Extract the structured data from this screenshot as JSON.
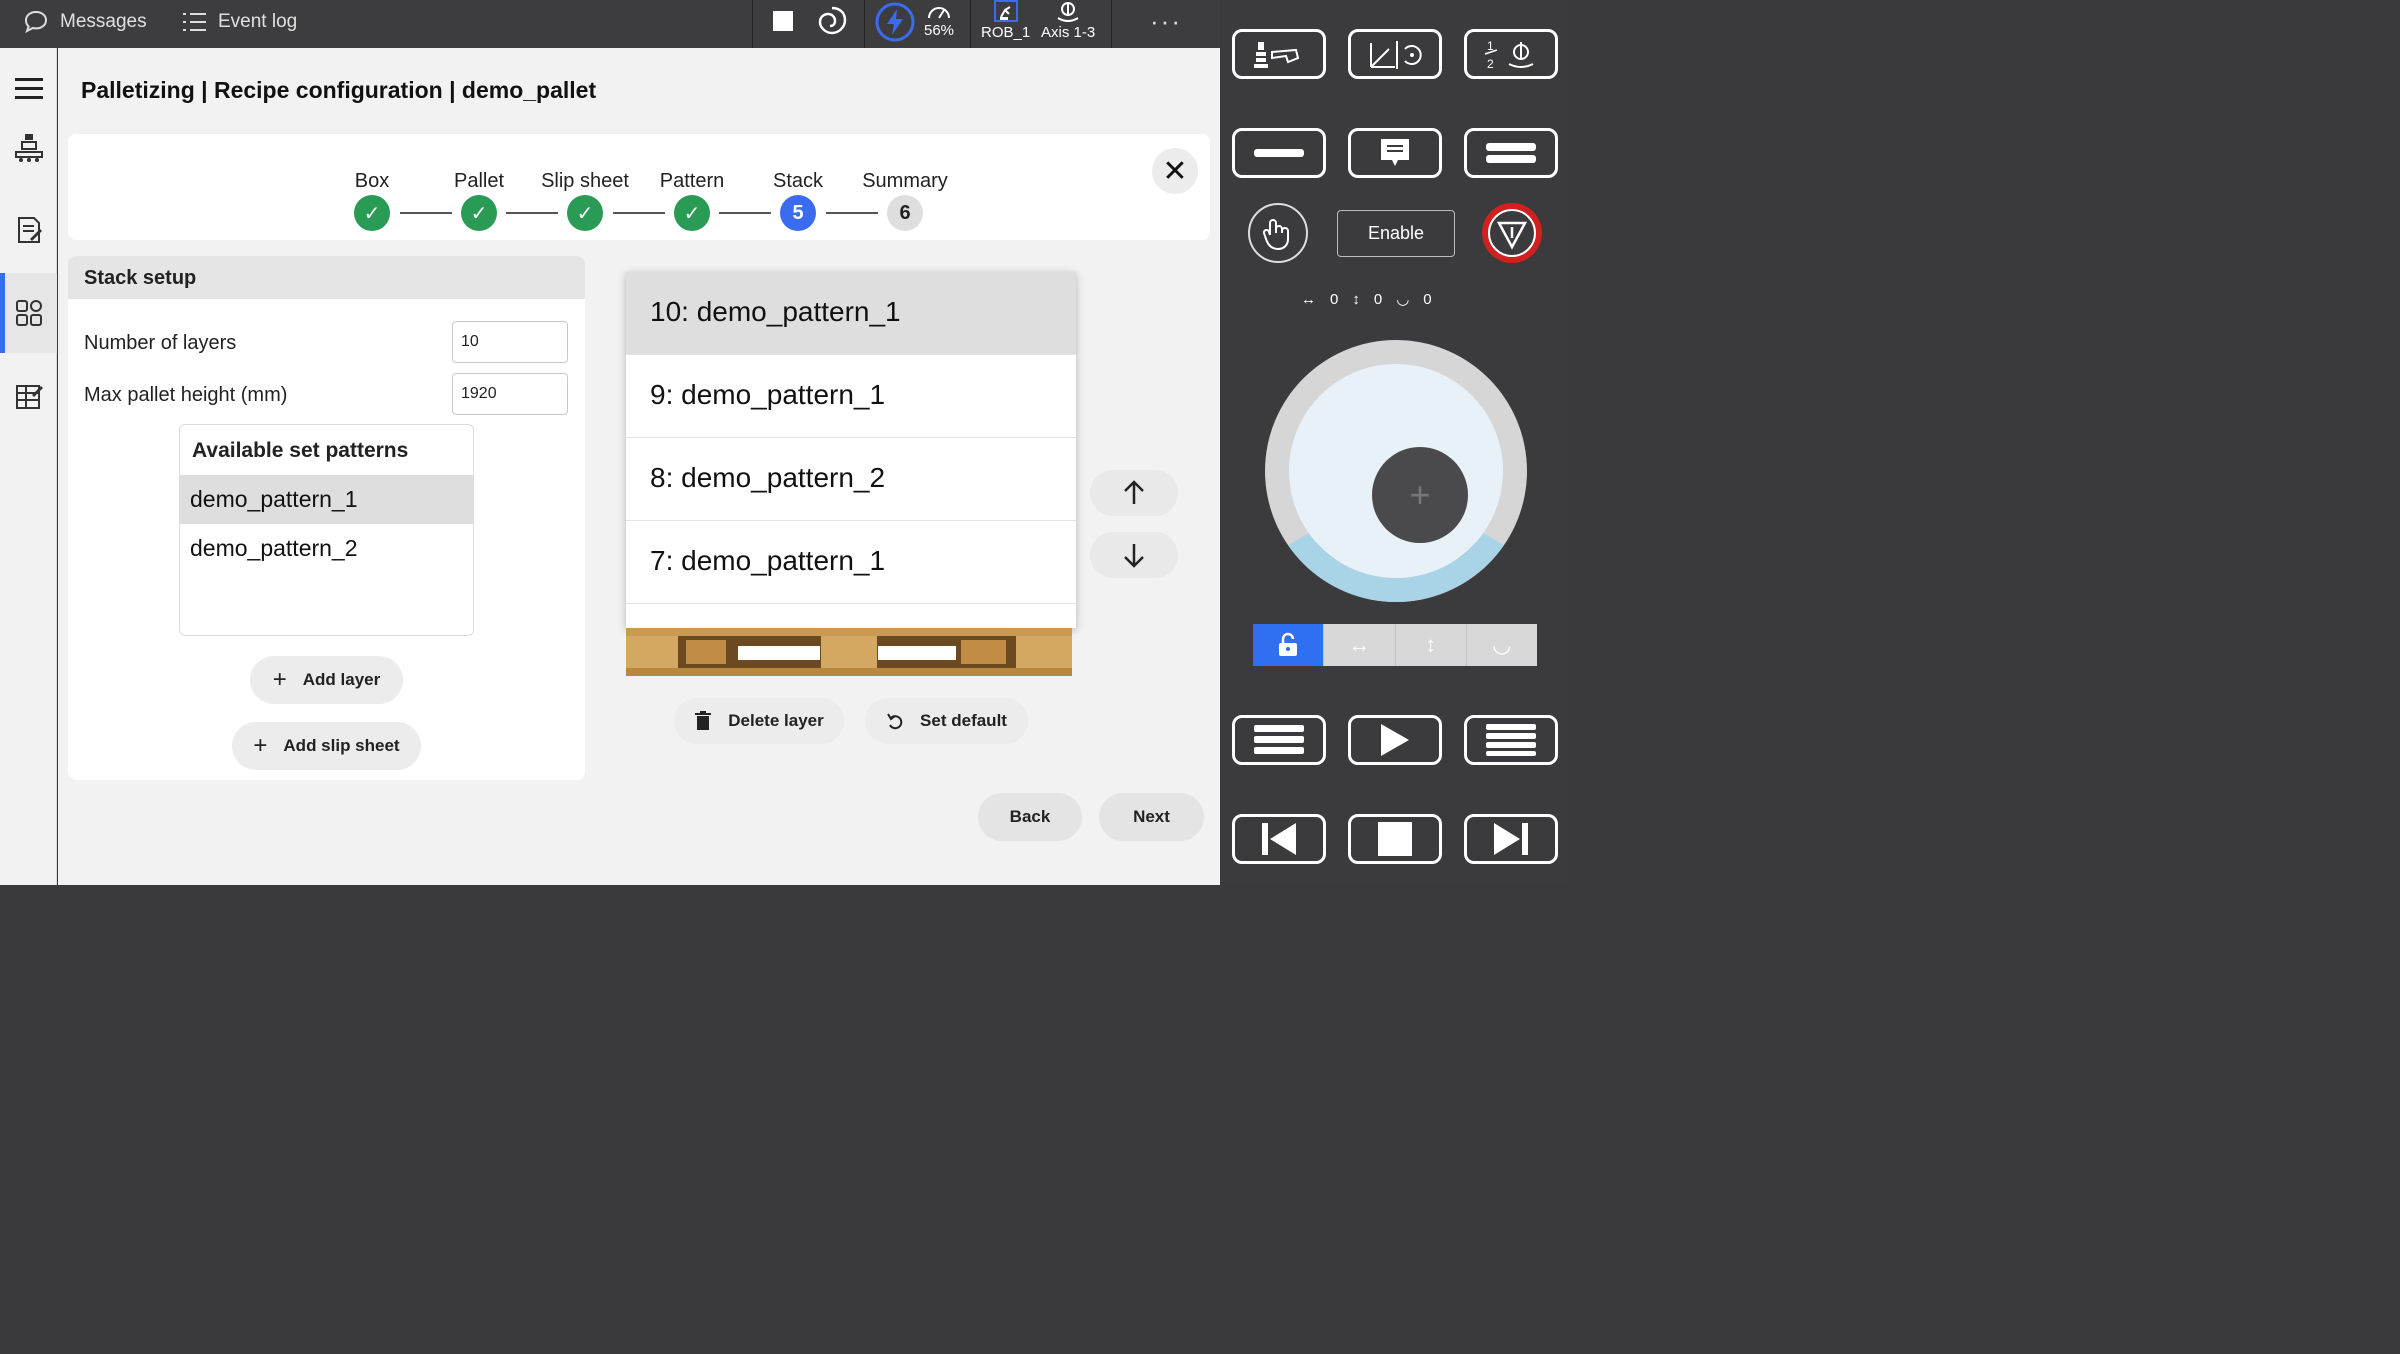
{
  "topbar": {
    "messages_label": "Messages",
    "eventlog_label": "Event log",
    "speed_label": "56%",
    "rob_label": "ROB_1",
    "axis_label": "Axis 1-3",
    "more_label": "···"
  },
  "page": {
    "title": "Palletizing | Recipe configuration | demo_pallet"
  },
  "stepper": {
    "steps": [
      {
        "label": "Box",
        "status": "done",
        "mark": "✓"
      },
      {
        "label": "Pallet",
        "status": "done",
        "mark": "✓"
      },
      {
        "label": "Slip sheet",
        "status": "done",
        "mark": "✓"
      },
      {
        "label": "Pattern",
        "status": "done",
        "mark": "✓"
      },
      {
        "label": "Stack",
        "status": "active",
        "mark": "5"
      },
      {
        "label": "Summary",
        "status": "todo",
        "mark": "6"
      }
    ],
    "close_glyph": "✕"
  },
  "setup": {
    "header": "Stack setup",
    "layers_label": "Number of layers",
    "layers_value": "10",
    "height_label": "Max pallet height (mm)",
    "height_value": "1920",
    "available_title": "Available set patterns",
    "available": [
      "demo_pattern_1",
      "demo_pattern_2"
    ],
    "add_layer": "Add layer",
    "add_slip_sheet": "Add slip sheet"
  },
  "stack": {
    "layers": [
      "10: demo_pattern_1",
      "9: demo_pattern_1",
      "8: demo_pattern_2",
      "7: demo_pattern_1"
    ],
    "delete_layer": "Delete layer",
    "set_default": "Set default"
  },
  "nav": {
    "back": "Back",
    "next": "Next"
  },
  "panel": {
    "enable_label": "Enable",
    "readout": [
      "0",
      "0",
      "0"
    ],
    "accent": "#2f6ff0",
    "stop_ring": "#d02020"
  }
}
